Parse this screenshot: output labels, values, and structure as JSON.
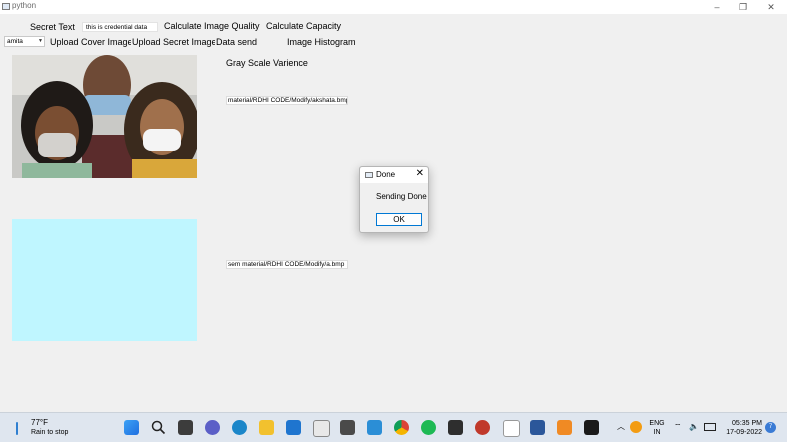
{
  "window": {
    "title": "python",
    "minimize": "–",
    "restore": "❐",
    "close": "✕"
  },
  "form": {
    "secret_label": "Secret Text",
    "secret_value": "this is credential data",
    "combo_value": "amita",
    "buttons": {
      "calc_quality": "Calculate Image Quality",
      "calc_capacity": "Calculate Capacity",
      "upload_cover": "Upload Cover Image",
      "upload_secret": "Upload Secret Image",
      "data_send": "Data send",
      "histogram": "Image Histogram",
      "gray_variance": "Gray Scale Varience"
    },
    "path_cover": "material/RDHI CODE/Modify/akshata.bmp",
    "path_output": "sem material/RDHI CODE/Modify/a.bmp"
  },
  "dialog": {
    "title": "Done",
    "message": "Sending Done",
    "ok": "OK",
    "close": "✕"
  },
  "taskbar": {
    "temperature": "77°F",
    "weather": "Rain to stop",
    "lang_top": "ENG",
    "lang_bottom": "IN",
    "time": "05:35 PM",
    "date": "17-09-2022",
    "notification_count": "7",
    "icons": [
      "windows-start",
      "search",
      "task-view",
      "chat",
      "edge",
      "file-explorer",
      "mail",
      "store",
      "camera",
      "snipping",
      "chrome",
      "spotify",
      "terminal",
      "settings",
      "notepad",
      "word",
      "xampp",
      "cmd"
    ]
  },
  "colors": {
    "preview_fill": "#bff6ff",
    "taskbar": "#dfe6ef",
    "accent": "#0078d4"
  }
}
